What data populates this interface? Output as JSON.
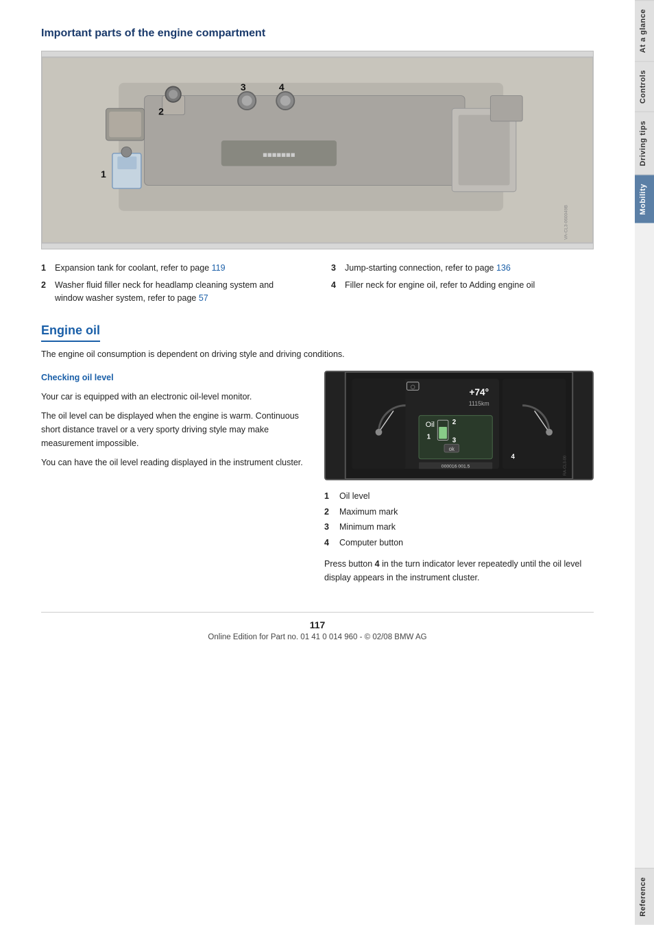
{
  "page": {
    "number": "117",
    "footer_text": "Online Edition for Part no. 01 41 0 014 960 - © 02/08 BMW AG"
  },
  "sidebar": {
    "tabs": [
      {
        "id": "at-a-glance",
        "label": "At a glance",
        "active": false
      },
      {
        "id": "controls",
        "label": "Controls",
        "active": false
      },
      {
        "id": "driving-tips",
        "label": "Driving tips",
        "active": false
      },
      {
        "id": "mobility",
        "label": "Mobility",
        "active": true
      },
      {
        "id": "reference",
        "label": "Reference",
        "active": false
      }
    ]
  },
  "engine_compartment": {
    "title": "Important parts of the engine compartment",
    "labels": [
      "1",
      "2",
      "3",
      "4"
    ],
    "parts": [
      {
        "num": "1",
        "text": "Expansion tank for coolant, refer to page ",
        "link": "119",
        "col": "left"
      },
      {
        "num": "2",
        "text": "Washer fluid filler neck for headlamp cleaning system and window washer system, refer to page ",
        "link": "57",
        "col": "left"
      },
      {
        "num": "3",
        "text": "Jump-starting connection, refer to page ",
        "link": "136",
        "col": "right"
      },
      {
        "num": "4",
        "text": "Filler neck for engine oil, refer to Adding engine oil",
        "link": "",
        "col": "right"
      }
    ]
  },
  "engine_oil": {
    "title": "Engine oil",
    "intro": "The engine oil consumption is dependent on driving style and driving conditions.",
    "checking_oil_level": {
      "subtitle": "Checking oil level",
      "paragraphs": [
        "Your car is equipped with an electronic oil-level monitor.",
        "The oil level can be displayed when the engine is warm. Continuous short distance travel or a very sporty driving style may make measurement impossible.",
        "You can have the oil level reading displayed in the instrument cluster."
      ]
    },
    "cluster_labels": [
      {
        "num": "1",
        "label": "Oil level"
      },
      {
        "num": "2",
        "label": "Maximum mark"
      },
      {
        "num": "3",
        "label": "Minimum mark"
      },
      {
        "num": "4",
        "label": "Computer button"
      }
    ],
    "press_text": "Press button ",
    "press_bold": "4",
    "press_text2": " in the turn indicator lever repeatedly until the oil level display appears in the instrument cluster."
  }
}
